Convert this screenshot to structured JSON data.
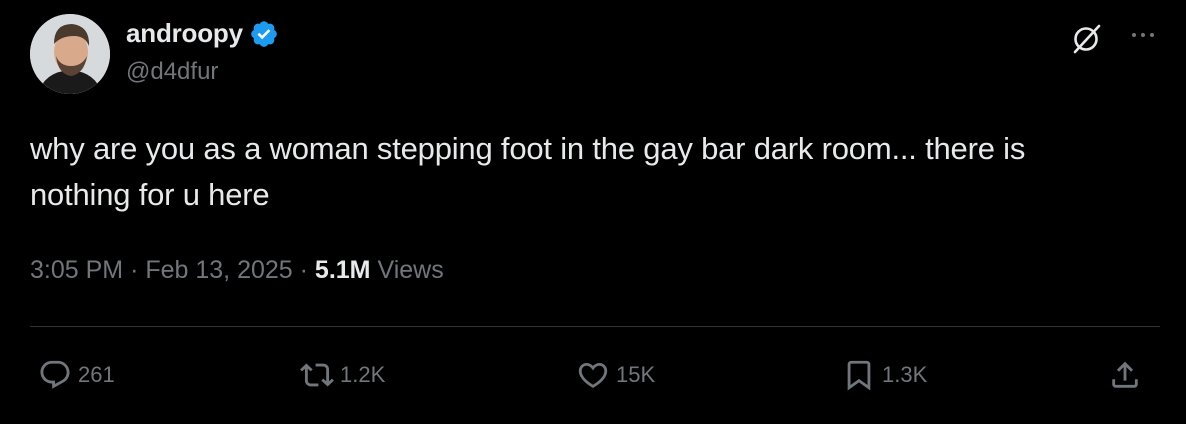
{
  "tweet": {
    "author": {
      "name": "androopy",
      "handle": "@d4dfur",
      "verified": true,
      "verified_color": "#1d9bf0",
      "avatar": "profile-photo"
    },
    "text_line1": "why are you as a woman stepping foot in the gay bar dark room... there is",
    "text_line2": "nothing for u here",
    "time": "3:05 PM",
    "date": "Feb 13, 2025",
    "views_count": "5.1M",
    "views_label": "Views",
    "separator": "·"
  },
  "actions": {
    "replies": "261",
    "reposts": "1.2K",
    "likes": "15K",
    "bookmarks": "1.3K"
  },
  "icons": [
    "grok-icon",
    "more-icon",
    "reply-icon",
    "retweet-icon",
    "like-icon",
    "bookmark-icon",
    "share-icon"
  ],
  "colors": {
    "background": "#000000",
    "text": "#e7e9ea",
    "secondary": "#71767b",
    "divider": "#2f3336"
  }
}
